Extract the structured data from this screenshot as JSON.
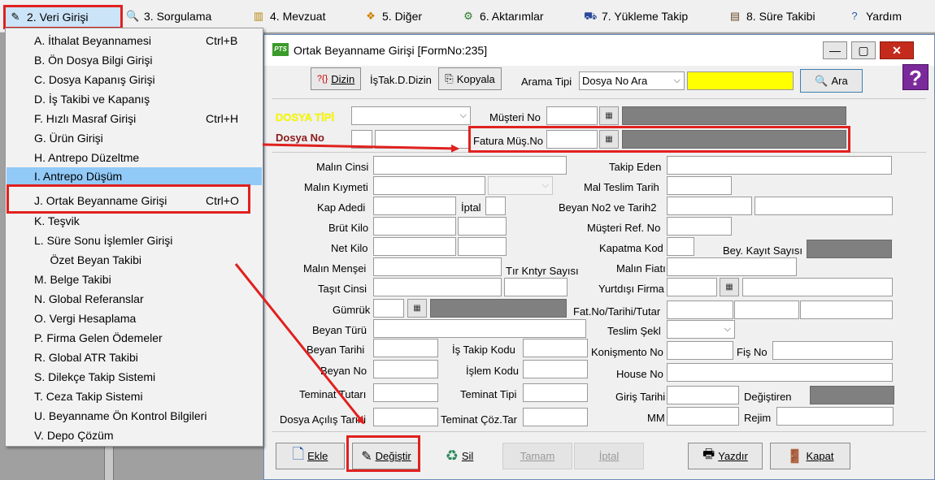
{
  "menubar": {
    "items": [
      {
        "label": "2.  Veri Girişi",
        "icon": "edit-icon"
      },
      {
        "label": "3.  Sorgulama",
        "icon": "magnifier-icon"
      },
      {
        "label": "4.  Mevzuat",
        "icon": "books-icon"
      },
      {
        "label": "5.  Diğer",
        "icon": "cubes-icon"
      },
      {
        "label": "6.  Aktarımlar",
        "icon": "gear-icon"
      },
      {
        "label": "7.  Yükleme Takip",
        "icon": "truck-icon"
      },
      {
        "label": "8. Süre Takibi",
        "icon": "clipboard-icon"
      },
      {
        "label": "Yardım",
        "icon": "help-icon"
      }
    ]
  },
  "dropdown": {
    "items": [
      {
        "label": "A.   İthalat Beyannamesi",
        "shortcut": "Ctrl+B"
      },
      {
        "label": "B.   Ön Dosya Bilgi Girişi",
        "shortcut": ""
      },
      {
        "label": "C.   Dosya Kapanış Girişi",
        "shortcut": ""
      },
      {
        "label": "D.   İş Takibi ve Kapanış",
        "shortcut": ""
      },
      {
        "label": "F.   Hızlı Masraf Girişi",
        "shortcut": "Ctrl+H"
      },
      {
        "label": "G.   Ürün Girişi",
        "shortcut": ""
      },
      {
        "label": "H.   Antrepo Düzeltme",
        "shortcut": ""
      },
      {
        "label": "I.    Antrepo Düşüm",
        "shortcut": ""
      },
      {
        "label": "J.   Ortak Beyanname Girişi",
        "shortcut": "Ctrl+O"
      },
      {
        "label": "K.   Teşvik",
        "shortcut": ""
      },
      {
        "label": "L.   Süre Sonu İşlemler Girişi",
        "shortcut": ""
      },
      {
        "label": "     Özet Beyan Takibi",
        "shortcut": ""
      },
      {
        "label": "M.   Belge Takibi",
        "shortcut": ""
      },
      {
        "label": "N.  Global Referanslar",
        "shortcut": ""
      },
      {
        "label": "O. Vergi Hesaplama",
        "shortcut": ""
      },
      {
        "label": "P. Firma Gelen Ödemeler",
        "shortcut": ""
      },
      {
        "label": "R. Global ATR Takibi",
        "shortcut": ""
      },
      {
        "label": "S. Dilekçe Takip Sistemi",
        "shortcut": ""
      },
      {
        "label": "T. Ceza Takip Sistemi",
        "shortcut": ""
      },
      {
        "label": "U. Beyanname Ön Kontrol Bilgileri",
        "shortcut": ""
      },
      {
        "label": "V. Depo Çözüm",
        "shortcut": ""
      }
    ]
  },
  "window": {
    "title": "Ortak Beyanname Girişi [FormNo:235]",
    "logo_text": "PTS",
    "min_label": "—",
    "max_label": "▢",
    "close_label": "✕",
    "help_label": "?"
  },
  "toolbar": {
    "dizin_label": "Dizin",
    "dizin_prefix": "?{}",
    "istak_label": "İşTak.D.Dizin",
    "kopyala_label": "Kopyala",
    "arama_tipi_label": "Arama Tipi",
    "arama_tipi_value": "Dosya No Ara",
    "search_value": "",
    "ara_label": "Ara"
  },
  "header_fields": {
    "dosya_tipi_label": "DOSYA TİPİ",
    "dosya_no_label": "Dosya No",
    "musteri_no_label": "Müşteri No",
    "fatura_mus_no_label": "Fatura Müş.No"
  },
  "form_labels": {
    "malin_cinsi": "Malın Cinsi",
    "malin_kiymeti": "Malın Kıymeti",
    "kap_adedi": "Kap Adedi",
    "iptal": "İptal",
    "brut_kilo": "Brüt Kilo",
    "net_kilo": "Net Kilo",
    "malin_mensei": "Malın Menşei",
    "tir_kntyr_sayisi": "Tır Kntyr Sayısı",
    "tasit_cinsi": "Taşıt Cinsi",
    "gumruk": "Gümrük",
    "beyan_turu": "Beyan Türü",
    "beyan_tarihi": "Beyan Tarihi",
    "is_takip_kodu": "İş Takip Kodu",
    "beyan_no": "Beyan No",
    "islem_kodu": "İşlem Kodu",
    "teminat_tutari": "Teminat Tutarı",
    "teminat_tipi": "Teminat Tipi",
    "dosya_acilis_tarihi": "Dosya Açılış Tarihi",
    "teminat_coz_tar": "Teminat Çöz.Tar",
    "takip_eden": "Takip Eden",
    "mal_teslim_tarih": "Mal Teslim Tarih",
    "beyan_no2_tarih2": "Beyan  No2 ve Tarih2",
    "musteri_ref_no": "Müşteri  Ref. No",
    "kapatma_kod": "Kapatma Kod",
    "bey_kayit_sayisi": "Bey. Kayıt Sayısı",
    "malin_fiati": "Malın Fiatı",
    "yurtdisi_firma": "Yurtdışı Firma",
    "fat_no_tarihi_tutar": "Fat.No/Tarihi/Tutar",
    "teslim_sekli": "Teslim Şekl",
    "konismento_no": "Konişmento No",
    "fis_no": "Fiş No",
    "house_no": "House No",
    "giris_tarihi": "Giriş Tarihi",
    "degistiren": "Değiştiren",
    "mm": "MM",
    "rejim": "Rejim"
  },
  "bottom_buttons": {
    "ekle": "Ekle",
    "degistir": "Değiştir",
    "sil": "Sil",
    "tamam": "Tamam",
    "iptal": "İptal",
    "yazdir": "Yazdır",
    "kapat": "Kapat"
  },
  "colors": {
    "highlight_red": "#e0211f",
    "menu_highlight": "#91c9f7",
    "dosya_tipi_yellow": "#ffff00",
    "dosya_no_maroon": "#8b1a1a"
  }
}
